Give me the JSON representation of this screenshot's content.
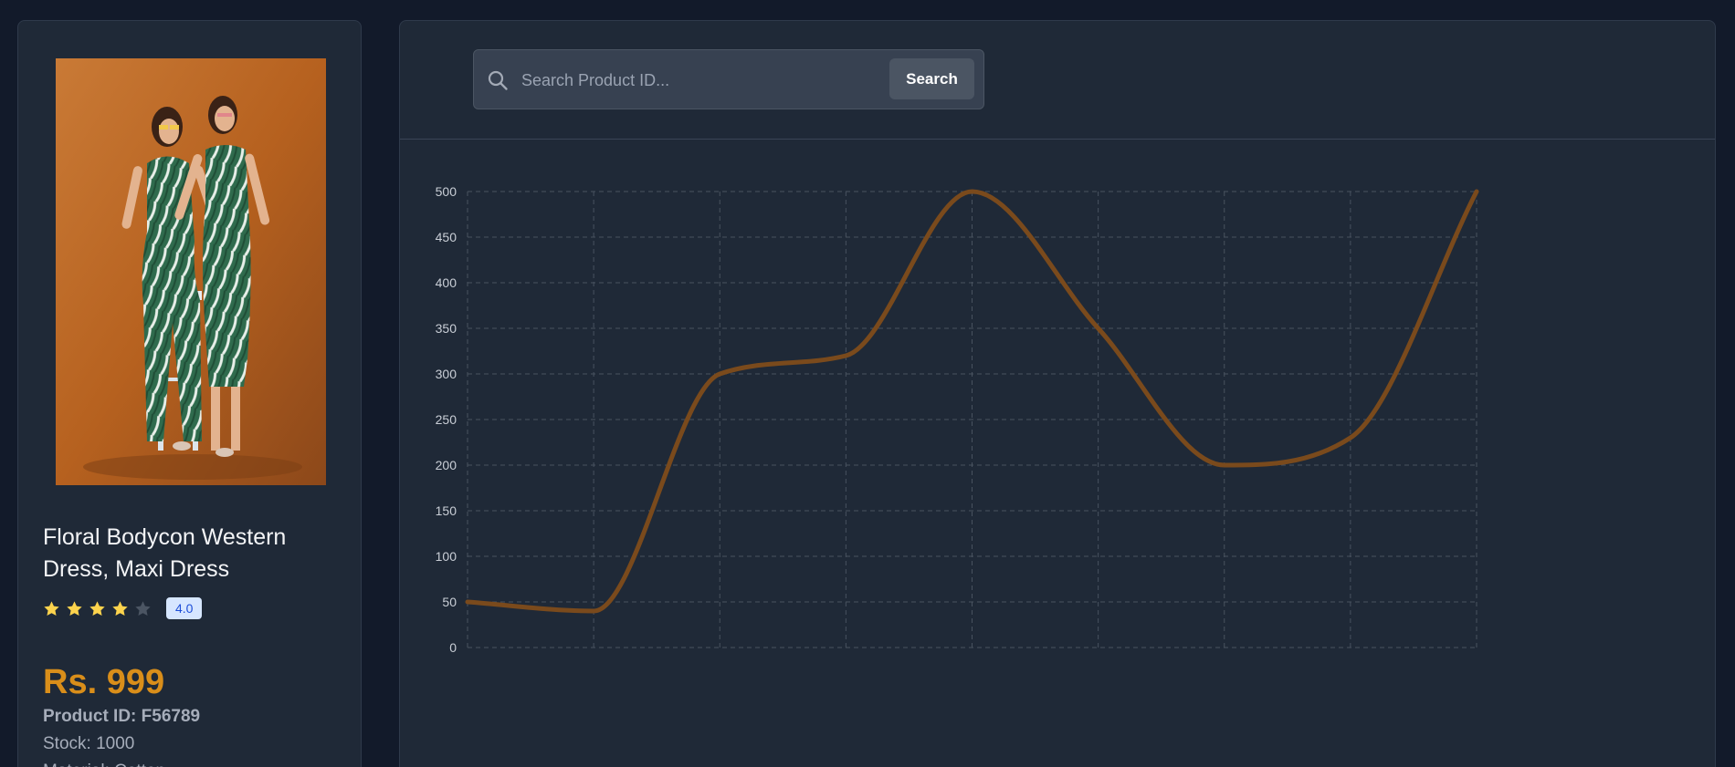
{
  "product": {
    "title_line1": "Floral Bodycon Western",
    "title_line2": "Dress, Maxi Dress",
    "rating_value": 4.0,
    "rating_max": 5,
    "rating_label": "4.0",
    "price": "Rs. 999",
    "product_id": "Product ID: F56789",
    "stock": "Stock: 1000",
    "material": "Material: Cotton",
    "image_icon": "product-photo"
  },
  "search": {
    "placeholder": "Search Product ID...",
    "value": "",
    "button_label": "Search"
  },
  "colors": {
    "star_filled": "#fcd34d",
    "star_empty": "#4b5563",
    "price": "#d98e1a",
    "line": "#7a4a1c",
    "grid": "#48525f"
  },
  "chart_data": {
    "type": "line",
    "x": [
      0,
      1,
      2,
      3,
      4,
      5,
      6,
      7,
      8
    ],
    "series": [
      {
        "values": [
          50,
          40,
          300,
          320,
          500,
          350,
          200,
          230,
          500
        ]
      }
    ],
    "y_ticks": [
      "0",
      "50",
      "100",
      "150",
      "200",
      "250",
      "300",
      "350",
      "400",
      "450",
      "500"
    ],
    "ylim": [
      0,
      500
    ],
    "grid": true,
    "curve": "smooth"
  }
}
